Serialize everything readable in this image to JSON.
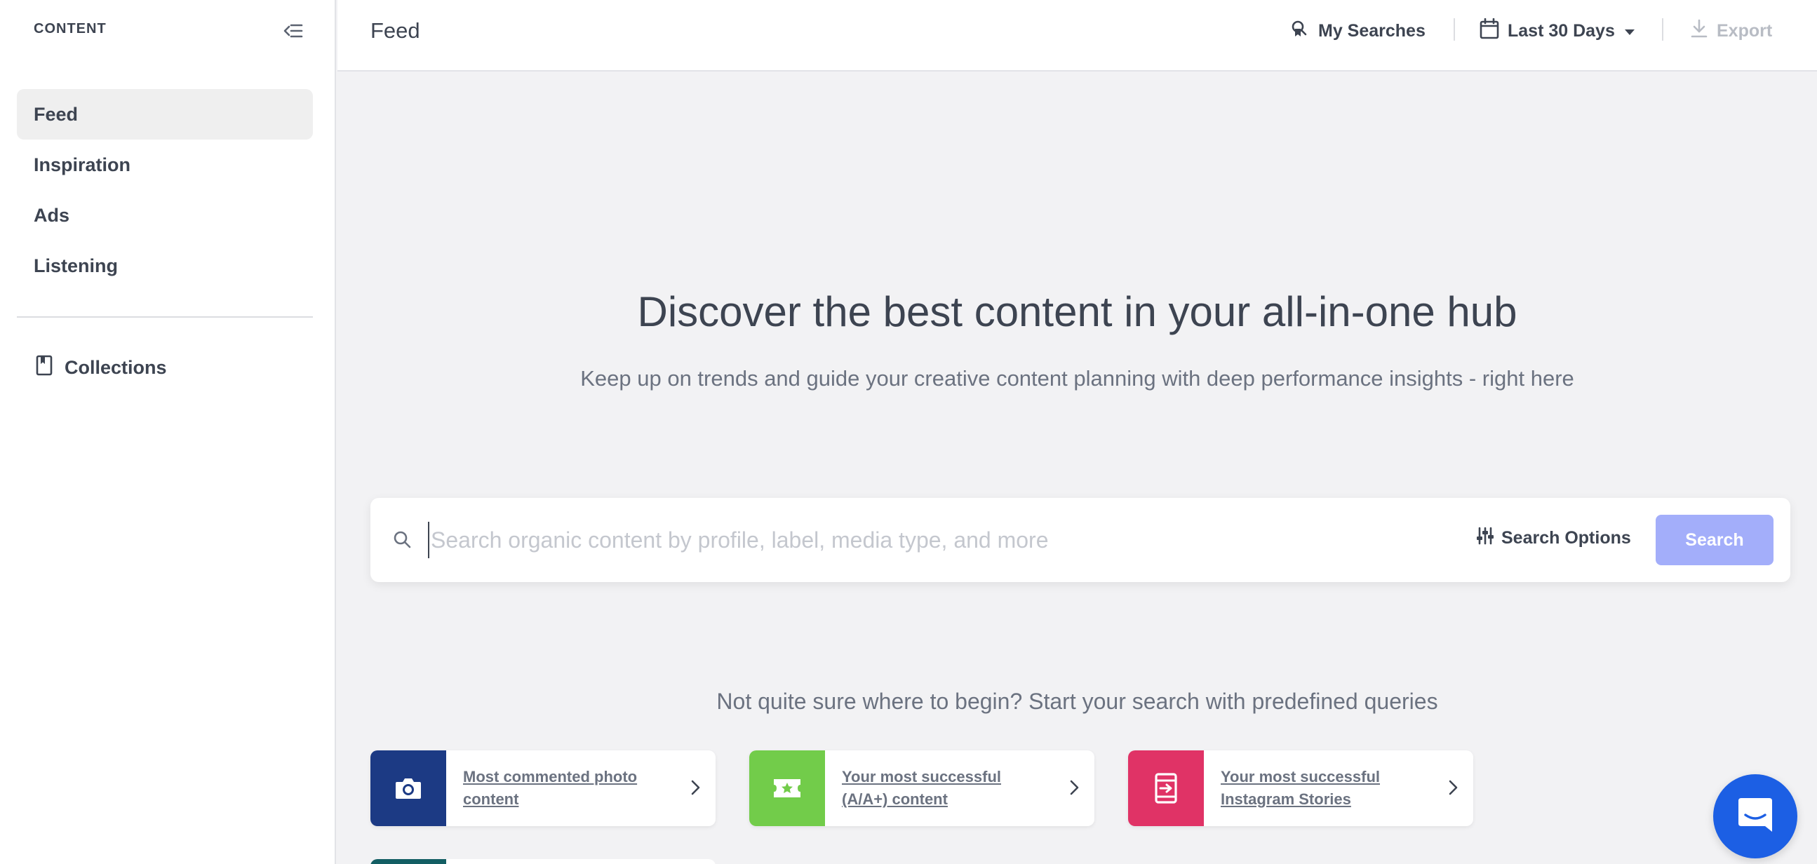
{
  "sidebar": {
    "header": "CONTENT",
    "items": [
      {
        "label": "Feed",
        "active": true
      },
      {
        "label": "Inspiration"
      },
      {
        "label": "Ads"
      },
      {
        "label": "Listening"
      }
    ],
    "collections_label": "Collections"
  },
  "topbar": {
    "title": "Feed",
    "my_searches": "My Searches",
    "date_range": "Last 30 Days",
    "export": "Export"
  },
  "hero": {
    "title": "Discover the best content in your all-in-one hub",
    "subtitle": "Keep up on trends and guide your creative content planning with deep performance insights - right here"
  },
  "search": {
    "placeholder": "Search organic content by profile, label, media type, and more",
    "options_label": "Search Options",
    "button_label": "Search"
  },
  "predefined": {
    "title": "Not quite sure where to begin? Start your search with predefined queries",
    "cards": [
      {
        "label": "Most commented photo content",
        "icon": "camera-icon",
        "color": "#1c3a84"
      },
      {
        "label": "Your most successful (A/A+) content",
        "icon": "star-ticket-icon",
        "color": "#72cc4a"
      },
      {
        "label": "Your most successful Instagram Stories",
        "icon": "story-icon",
        "color": "#e03366"
      }
    ]
  },
  "colors": {
    "accent": "#a3aefa",
    "chat": "#1c5fe4"
  }
}
